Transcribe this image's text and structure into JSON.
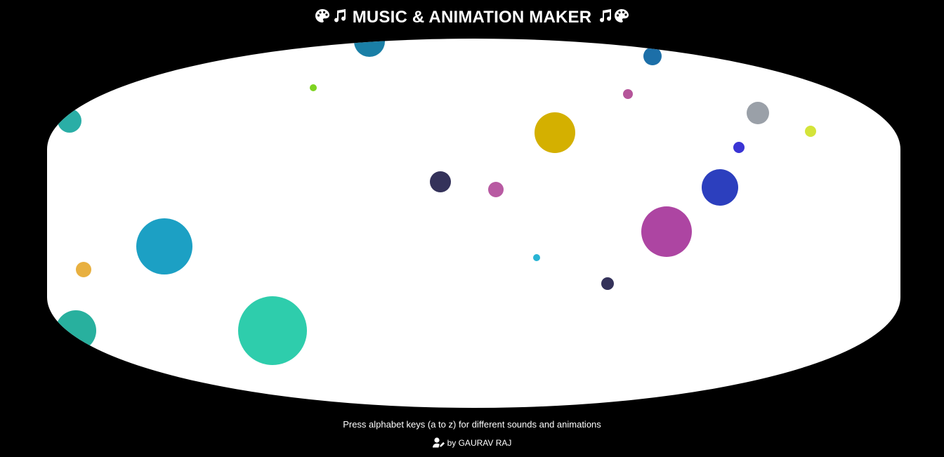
{
  "header": {
    "icon_left_1": "palette-icon",
    "icon_left_2": "music-note-icon",
    "title": "MUSIC & ANIMATION MAKER",
    "icon_right_1": "music-note-icon",
    "icon_right_2": "palette-icon"
  },
  "canvas": {
    "background": "#ffffff",
    "circles": [
      {
        "color": "#1a7fa6",
        "label": "circle-dark-blue-top"
      },
      {
        "color": "#1c6fa8",
        "label": "circle-blue-top-right"
      },
      {
        "color": "#7ed321",
        "label": "circle-lime-small"
      },
      {
        "color": "#b5559a",
        "label": "circle-pink-small"
      },
      {
        "color": "#2aaea6",
        "label": "circle-teal-left"
      },
      {
        "color": "#9aa0a8",
        "label": "circle-grey"
      },
      {
        "color": "#d4e43a",
        "label": "circle-yellow-green"
      },
      {
        "color": "#d4b000",
        "label": "circle-gold"
      },
      {
        "color": "#3a34d4",
        "label": "circle-blue-small"
      },
      {
        "color": "#34325a",
        "label": "circle-navy"
      },
      {
        "color": "#b85aa2",
        "label": "circle-pink"
      },
      {
        "color": "#2c3fbe",
        "label": "circle-royal-blue"
      },
      {
        "color": "#ad45a2",
        "label": "circle-magenta"
      },
      {
        "color": "#1ca0c4",
        "label": "circle-cerulean"
      },
      {
        "color": "#e8b040",
        "label": "circle-amber"
      },
      {
        "color": "#28b4d4",
        "label": "circle-cyan-tiny"
      },
      {
        "color": "#34325a",
        "label": "circle-navy-small"
      },
      {
        "color": "#28b09e",
        "label": "circle-teal-bottom-left"
      },
      {
        "color": "#2ecdac",
        "label": "circle-mint-large"
      }
    ]
  },
  "footer": {
    "instructions": "Press alphabet keys (a to z) for different sounds and animations",
    "credit_icon": "user-edit-icon",
    "credit": "by GAURAV RAJ"
  }
}
